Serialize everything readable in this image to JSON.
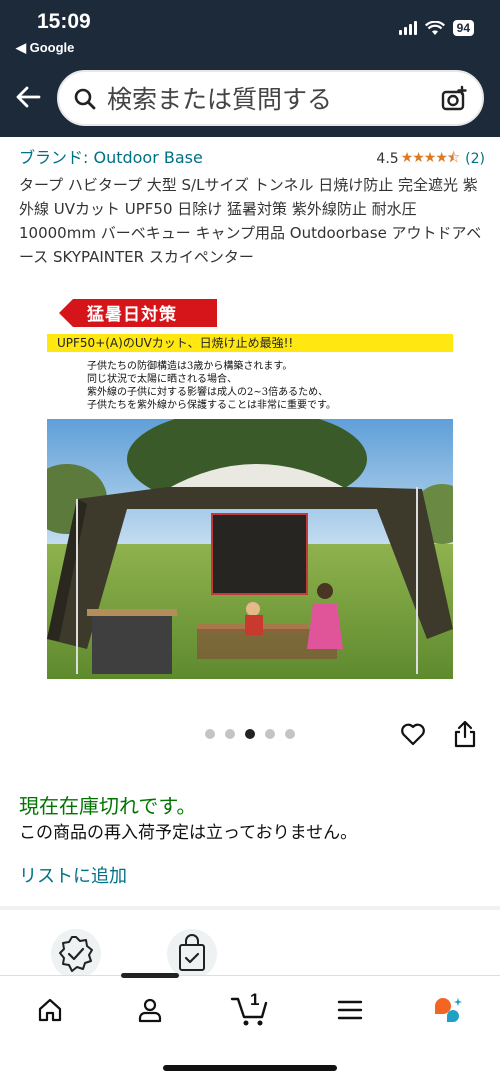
{
  "status_bar": {
    "time": "15:09",
    "back_app": "◀ Google",
    "battery": "94"
  },
  "search": {
    "placeholder": "検索または質問する"
  },
  "product": {
    "brand": "ブランド: Outdoor Base",
    "rating": "4.5",
    "stars": "★★★★⯪",
    "rating_count": "(2)",
    "title": "タープ ハビタープ 大型 S/Lサイズ トンネル 日焼け防止 完全遮光 紫外線 UVカット UPF50 日除け 猛暑対策 紫外線防止 耐水圧10000mm バーベキュー キャンプ用品 Outdoorbase アウトドアベース SKYPAINTER スカイペンター"
  },
  "image": {
    "tag": "猛暑日対策",
    "yellow_band": "UPF50+(A)のUVカット、日焼け止め最強!!",
    "desc_lines": [
      "子供たちの防御構造は3歳から構築されます。",
      "同じ状況で太陽に晒される場合、",
      "紫外線の子供に対する影響は成人の2~3倍あるため、",
      "子供たちを紫外線から保護することは非常に重要です。"
    ],
    "carousel": {
      "count": 5,
      "active_index": 2
    }
  },
  "availability": {
    "stock_status": "現在在庫切れです。",
    "restock_note": "この商品の再入荷予定は立っておりません。",
    "add_to_list": "リストに追加"
  },
  "bottom_nav": {
    "items": [
      "home-icon",
      "account-icon",
      "cart-icon",
      "menu-icon",
      "rufus-icon"
    ],
    "cart_count": "1",
    "active_index": 1
  },
  "colors": {
    "header_bg": "#1c2a3a",
    "link": "#007185",
    "in_stock_green": "#007600",
    "star": "#de7921"
  }
}
